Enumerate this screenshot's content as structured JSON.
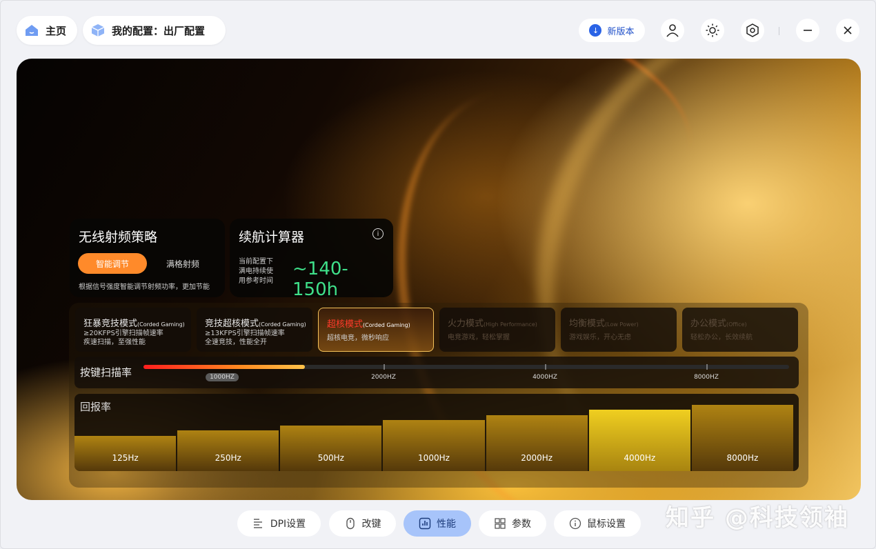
{
  "header": {
    "home_label": "主页",
    "config_label": "我的配置：出厂配置",
    "new_version_label": "新版本"
  },
  "wireless": {
    "title": "无线射频策略",
    "smart_label": "智能调节",
    "full_label": "满格射频",
    "note": "根据信号强度智能调节射频功率，更加节能"
  },
  "battery": {
    "title": "续航计算器",
    "note_line1": "当前配置下",
    "note_line2": "满电持续使",
    "note_line3": "用参考时间",
    "value": "~140-150h"
  },
  "modes": [
    {
      "title": "狂暴竞技模式",
      "tag": "(Corded Gaming)",
      "line1": "≥20KFPS引擎扫描帧速率",
      "line2": "疾速扫描，至强性能"
    },
    {
      "title": "竞技超核模式",
      "tag": "(Corded Gaming)",
      "line1": "≥13KFPS引擎扫描帧速率",
      "line2": "全速竞技，性能全开"
    },
    {
      "title": "超核模式",
      "tag": "(Corded Gaming)",
      "line1": "超核电竞，微秒响应",
      "line2": ""
    },
    {
      "title": "火力模式",
      "tag": "(High Performance)",
      "line1": "电竞游戏，轻松掌握",
      "line2": ""
    },
    {
      "title": "均衡模式",
      "tag": "(Low Power)",
      "line1": "游戏娱乐，开心无虑",
      "line2": ""
    },
    {
      "title": "办公模式",
      "tag": "(Office)",
      "line1": "轻松办公，长效续航",
      "line2": ""
    }
  ],
  "scan_rate": {
    "title": "按键扫描率",
    "labels": [
      "1000HZ",
      "2000HZ",
      "4000HZ",
      "8000HZ"
    ],
    "selected": "1000HZ",
    "fill_fraction": 0.25
  },
  "report_rate": {
    "title": "回报率",
    "options": [
      "125Hz",
      "250Hz",
      "500Hz",
      "1000Hz",
      "2000Hz",
      "4000Hz",
      "8000Hz"
    ],
    "selected": "4000Hz"
  },
  "tabs": [
    {
      "label": "DPI设置",
      "icon": "dpi-icon"
    },
    {
      "label": "改键",
      "icon": "mouse-icon"
    },
    {
      "label": "性能",
      "icon": "performance-icon"
    },
    {
      "label": "参数",
      "icon": "grid-icon"
    },
    {
      "label": "鼠标设置",
      "icon": "info-icon"
    }
  ],
  "active_tab": "性能",
  "watermark": "知乎 @科技领袖",
  "colors": {
    "accent_orange": "#ff8a2a",
    "active_tab": "#a7c4fa",
    "battery_value": "#3fe08a",
    "active_mode_text": "#ff3b2a"
  }
}
